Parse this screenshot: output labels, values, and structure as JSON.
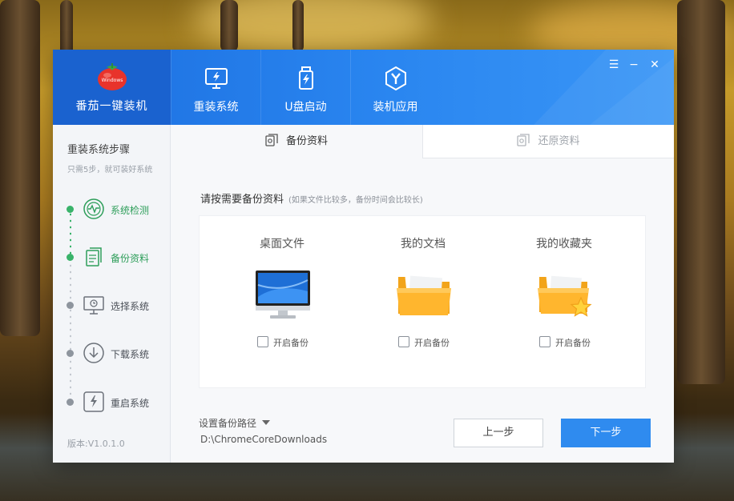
{
  "app": {
    "brand_name": "番茄一键装机",
    "logo_text": "Windows"
  },
  "nav": {
    "tabs": [
      {
        "label": "重装系统",
        "icon": "monitor-lightning-icon"
      },
      {
        "label": "U盘启动",
        "icon": "usb-lightning-icon"
      },
      {
        "label": "装机应用",
        "icon": "hexagon-y-icon"
      }
    ]
  },
  "window_controls": [
    "menu-icon",
    "minimize-icon",
    "close-icon"
  ],
  "sidebar": {
    "title": "重装系统步骤",
    "subtitle": "只需5步，就可装好系统",
    "steps": [
      {
        "label": "系统检测",
        "status": "done",
        "icon": "scan-icon"
      },
      {
        "label": "备份资料",
        "status": "done",
        "icon": "document-icon"
      },
      {
        "label": "选择系统",
        "status": "pending",
        "icon": "monitor-icon"
      },
      {
        "label": "下载系统",
        "status": "pending",
        "icon": "download-icon"
      },
      {
        "label": "重启系统",
        "status": "pending",
        "icon": "restart-icon"
      }
    ],
    "version": "版本:V1.0.1.0"
  },
  "tabs": {
    "backup": "备份资料",
    "restore": "还原资料"
  },
  "backup": {
    "heading": "请按需要备份资料",
    "hint": "(如果文件比较多，备份时间会比较长)",
    "items": [
      {
        "title": "桌面文件",
        "checkbox_label": "开启备份",
        "checked": false,
        "icon": "desktop-monitor-icon"
      },
      {
        "title": "我的文档",
        "checkbox_label": "开启备份",
        "checked": false,
        "icon": "folder-icon"
      },
      {
        "title": "我的收藏夹",
        "checkbox_label": "开启备份",
        "checked": false,
        "icon": "favorites-folder-icon"
      }
    ],
    "path_label": "设置备份路径",
    "path_value": "D:\\ChromeCoreDownloads"
  },
  "buttons": {
    "prev": "上一步",
    "next": "下一步"
  },
  "colors": {
    "header_blue": "#2a86f0",
    "brand_blue": "#1a62cf",
    "step_done_green": "#39b36a",
    "next_button": "#2f8bef"
  }
}
